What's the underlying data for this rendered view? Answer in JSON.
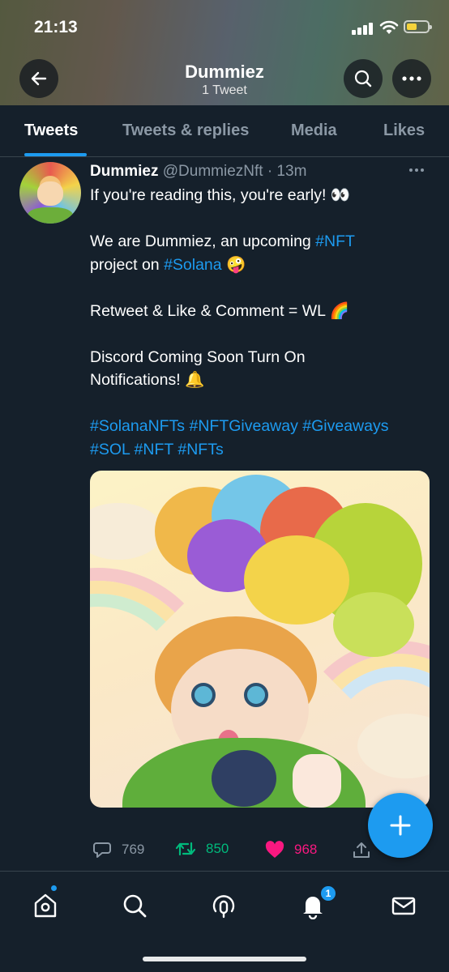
{
  "status_bar": {
    "time": "21:13"
  },
  "header": {
    "title": "Dummiez",
    "subtitle": "1 Tweet"
  },
  "tabs": [
    {
      "label": "Tweets",
      "active": true
    },
    {
      "label": "Tweets & replies",
      "active": false
    },
    {
      "label": "Media",
      "active": false
    },
    {
      "label": "Likes",
      "active": false
    }
  ],
  "tweet": {
    "display_name": "Dummiez",
    "handle": "@DummiezNft",
    "time": "· 13m",
    "lines": {
      "l1": "If you're reading this, you're early! 👀",
      "l2a": "We are Dummiez, an upcoming ",
      "l2tag": "#NFT",
      "l3a": "project on ",
      "l3tag": "#Solana",
      "l3b": " 🤪",
      "l4": "Retweet & Like & Comment = WL 🌈",
      "l5": "Discord Coming Soon Turn On",
      "l6": "Notifications!  🔔",
      "l7": "#SolanaNFTs #NFTGiveaway #Giveaways",
      "l8": "#SOL #NFT #NFTs"
    },
    "stats": {
      "replies": "769",
      "retweets": "850",
      "likes": "968"
    }
  },
  "bottom_nav": {
    "notification_count": "1"
  },
  "colors": {
    "background": "#15202b",
    "accent": "#1d9bf0",
    "retweet": "#00ba7c",
    "like": "#f91880",
    "muted": "#8b98a5"
  },
  "icons": [
    "back-arrow-icon",
    "search-icon",
    "more-icon",
    "reply-icon",
    "retweet-icon",
    "heart-icon",
    "share-icon",
    "home-icon",
    "explore-icon",
    "spaces-icon",
    "bell-icon",
    "mail-icon",
    "plus-icon"
  ]
}
